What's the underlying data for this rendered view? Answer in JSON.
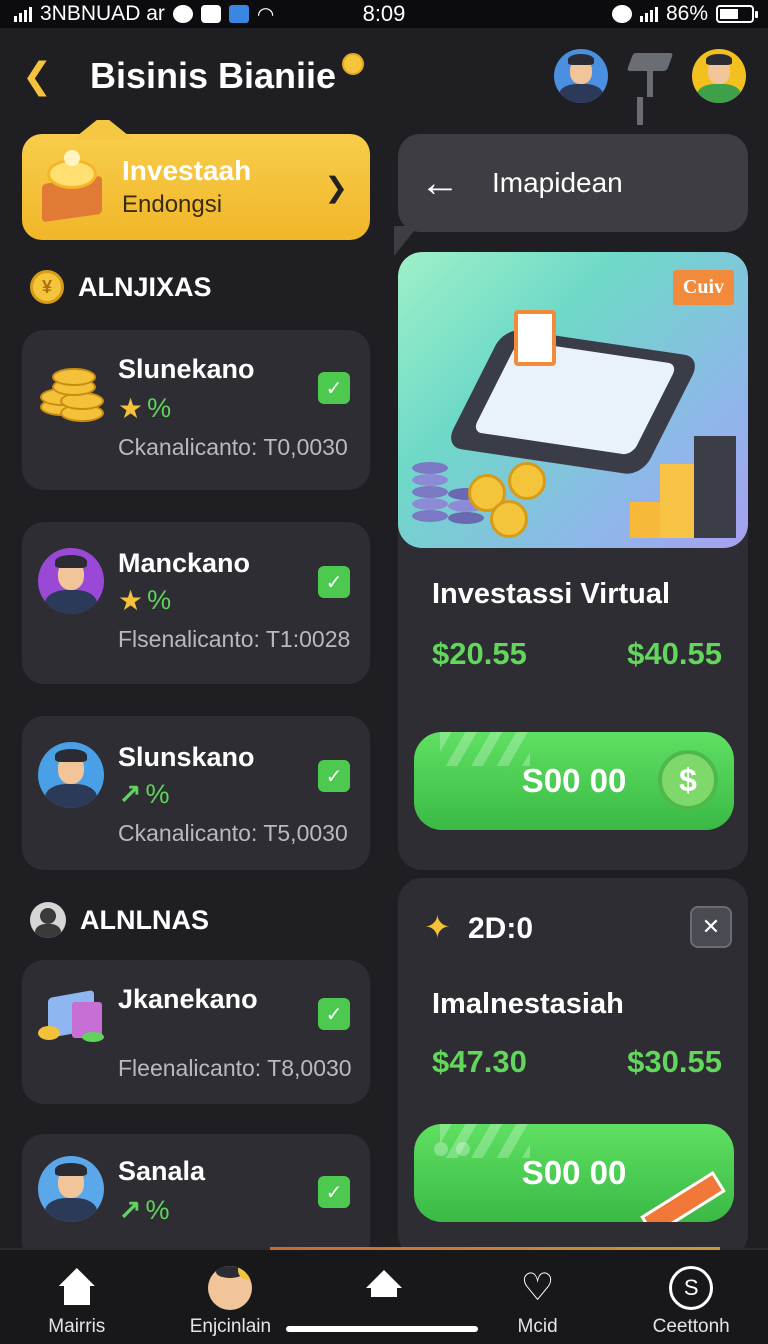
{
  "status_bar": {
    "carrier": "3NBNUAD ar",
    "time": "8:09",
    "battery": "86%"
  },
  "header": {
    "title": "Bisinis Bianiie"
  },
  "promo": {
    "title": "Investaah",
    "subtitle": "Endongsi"
  },
  "nav_card": {
    "label": "Imapidean"
  },
  "section1": {
    "title": "ALNJIXAS",
    "items": [
      {
        "name": "Slunekano",
        "rate": "%",
        "meta": "Ckanalicanto: T0,0030"
      },
      {
        "name": "Manckano",
        "rate": "%",
        "meta": "Flsenalicanto: T1:0028"
      },
      {
        "name": "Slunskano",
        "rate": "%",
        "meta": "Ckanalicanto: T5,0030"
      }
    ]
  },
  "section2": {
    "title": "ALNLNAS",
    "items": [
      {
        "name": "Jkanekano",
        "meta": "Fleenalicanto: T8,0030"
      },
      {
        "name": "Sanala",
        "rate": "%"
      }
    ]
  },
  "investment_card": {
    "badge": "Cuiv",
    "title": "Investassi Virtual",
    "value_left": "$20.55",
    "value_right": "$40.55",
    "cta_label": "S00 00",
    "cta_icon": "$"
  },
  "promo2_card": {
    "label": "2D:0",
    "title": "Imalnestasiah",
    "value_left": "$47.30",
    "value_right": "$30.55",
    "cta_label": "S00 00"
  },
  "bottom_nav": [
    {
      "label": "Mairris",
      "icon": "home-icon"
    },
    {
      "label": "Enjcinlain",
      "icon": "profile-icon"
    },
    {
      "label": "",
      "icon": "home-outline-icon"
    },
    {
      "label": "Mcid",
      "icon": "heart-icon"
    },
    {
      "label": "Ceettonh",
      "icon": "chat-icon"
    }
  ],
  "colors": {
    "background": "#1f1f23",
    "card": "#2d2d33",
    "accent_yellow": "#f4c43a",
    "accent_green": "#4cc94e",
    "value_green": "#62d75b"
  }
}
